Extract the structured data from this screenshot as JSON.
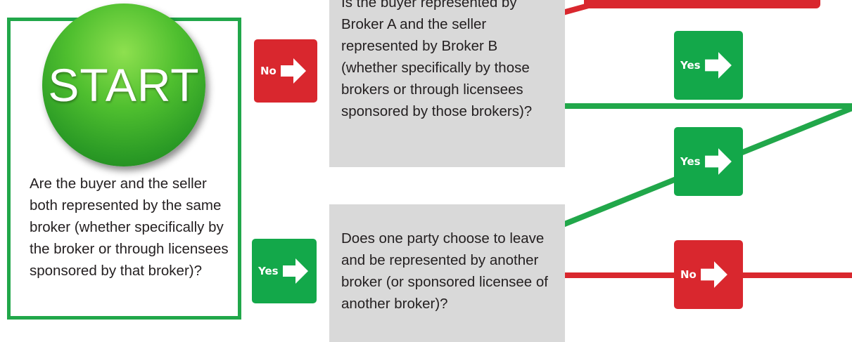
{
  "start": {
    "label": "START",
    "question": "Are the buyer and the seller both represented by the same broker (whether specifically by the broker or through licensees sponsored by that broker)?"
  },
  "question_top": "Is the buyer represented by Broker A and the seller represented by Broker B (whether specifically by those brokers or through licensees sponsored by those brokers)?",
  "question_bottom": "Does one party choose to leave and be represented by another broker (or sponsored licensee of another broker)?",
  "buttons": {
    "start_no": "No",
    "start_yes": "Yes",
    "top_yes": "Yes",
    "bottom_yes": "Yes",
    "bottom_no": "No"
  },
  "colors": {
    "green": "#13a84a",
    "red": "#d9272e",
    "gray": "#d9d9d9",
    "start_border": "#21a74a"
  }
}
